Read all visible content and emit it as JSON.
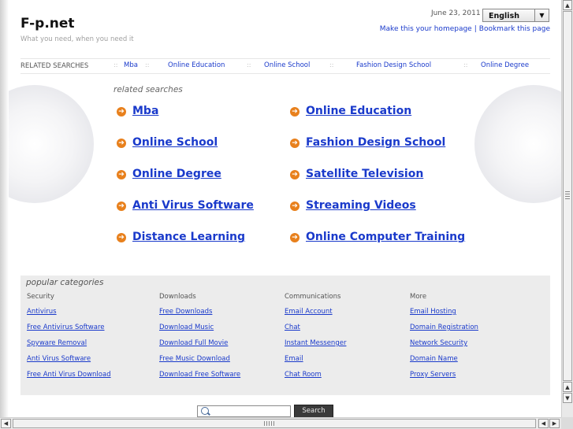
{
  "header": {
    "logo": "F-p.net",
    "tagline": "What you need, when you need it",
    "date": "June 23, 2011",
    "language": "English",
    "make_homepage": "Make this your homepage",
    "separator": "|",
    "bookmark": "Bookmark this page"
  },
  "related_bar": {
    "label": "RELATED SEARCHES",
    "separator": "::",
    "links": [
      "Mba",
      "Online Education",
      "Online School",
      "Fashion Design School",
      "Online Degree"
    ]
  },
  "related": {
    "heading": "related searches",
    "left": [
      "Mba",
      "Online School",
      "Online Degree",
      "Anti Virus Software",
      "Distance Learning"
    ],
    "right": [
      "Online Education",
      "Fashion Design School",
      "Satellite Television",
      "Streaming Videos",
      "Online Computer Training"
    ]
  },
  "popular": {
    "heading": "popular categories",
    "columns": [
      {
        "title": "Security",
        "links": [
          "Antivirus",
          "Free Antivirus Software",
          "Spyware Removal",
          "Anti Virus Software",
          "Free Anti Virus Download"
        ]
      },
      {
        "title": "Downloads",
        "links": [
          "Free Downloads",
          "Download Music",
          "Download Full Movie",
          "Free Music Download",
          "Download Free Software"
        ]
      },
      {
        "title": "Communications",
        "links": [
          "Email Account",
          "Chat",
          "Instant Messenger",
          "Email",
          "Chat Room"
        ]
      },
      {
        "title": "More",
        "links": [
          "Email Hosting",
          "Domain Registration",
          "Network Security",
          "Domain Name",
          "Proxy Servers"
        ]
      }
    ]
  },
  "search": {
    "value": "",
    "button": "Search"
  },
  "colors": {
    "link": "#1a3acb",
    "arrow": "#e8801c",
    "panel": "#ececec"
  },
  "icons": {
    "bullet": "circle-arrow-right-icon",
    "search": "magnifier-icon",
    "dropdown": "triangle-down-icon"
  }
}
